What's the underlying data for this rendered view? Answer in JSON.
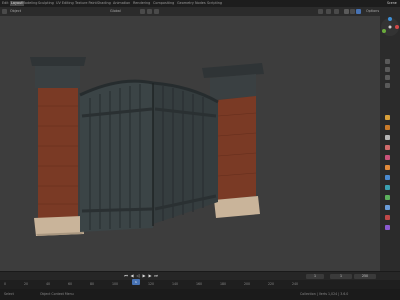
{
  "menu": {
    "left_tab": "Edit",
    "workspaces": [
      "Layout",
      "Modeling",
      "Sculpting",
      "UV Editing",
      "Texture Paint",
      "Shading",
      "Animation",
      "Rendering",
      "Compositing",
      "Geometry Nodes",
      "Scripting"
    ],
    "active_workspace": "Layout",
    "scene": "Scene"
  },
  "header": {
    "view": "Object",
    "orientation": "Global",
    "options": "Options"
  },
  "timeline": {
    "frame_start": "1",
    "frame_current": "1",
    "frame_end": "250",
    "ticks": [
      "0",
      "20",
      "40",
      "60",
      "80",
      "100",
      "120",
      "140",
      "160",
      "180",
      "200",
      "220",
      "240"
    ],
    "playhead": "1"
  },
  "status": {
    "left": "Select",
    "middle": "Object Context Menu",
    "right": "Collection | Verts 1,024 | 3.6.0"
  },
  "colors": {
    "accent": "#4772b3",
    "brick": "#7a3a25",
    "stone": "#c9b49a",
    "gate": "#3b4446"
  }
}
